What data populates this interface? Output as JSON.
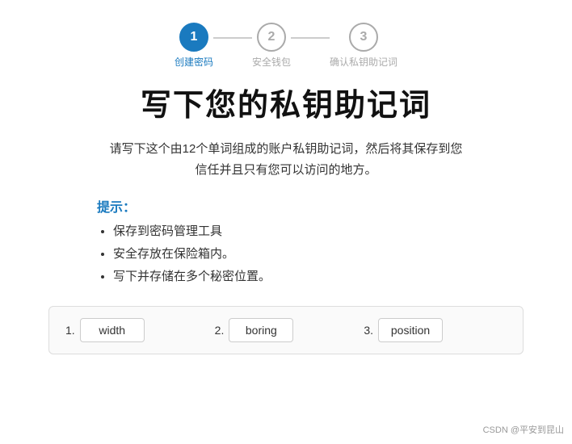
{
  "stepper": {
    "steps": [
      {
        "number": "1",
        "label": "创建密码",
        "state": "active"
      },
      {
        "number": "2",
        "label": "安全钱包",
        "state": "inactive"
      },
      {
        "number": "3",
        "label": "确认私钥助记词",
        "state": "inactive"
      }
    ]
  },
  "page_title": "写下您的私钥助记词",
  "description": "请写下这个由12个单词组成的账户私钥助记词，然后将其保存到您\n信任并且只有您可以访问的地方。",
  "tips": {
    "title": "提示：",
    "items": [
      "保存到密码管理工具",
      "安全存放在保险箱内。",
      "写下并存储在多个秘密位置。"
    ]
  },
  "mnemonic": {
    "words": [
      {
        "index": "1.",
        "word": "width"
      },
      {
        "index": "2.",
        "word": "boring"
      },
      {
        "index": "3.",
        "word": "position"
      }
    ]
  },
  "watermark": "CSDN @平安到昆山"
}
